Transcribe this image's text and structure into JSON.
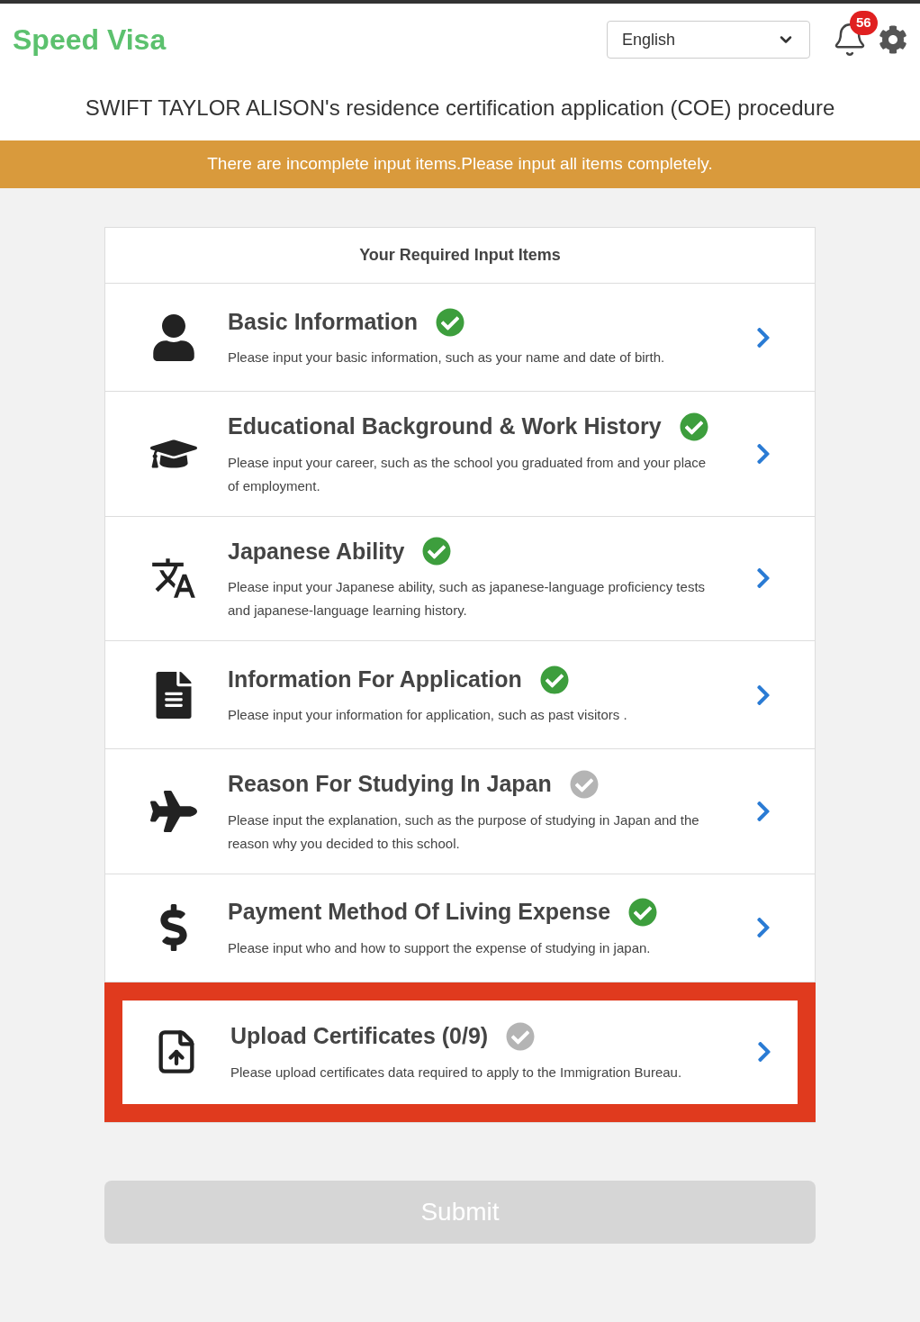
{
  "header": {
    "logo": "Speed Visa",
    "language": "English",
    "notification_count": "56"
  },
  "title": "SWIFT TAYLOR ALISON's residence certification application (COE) procedure",
  "alert": "There are incomplete input items.Please input all items completely.",
  "card": {
    "heading": "Your Required Input Items",
    "items": [
      {
        "title": "Basic Information",
        "description": "Please input your basic information, such as your name and date of birth.",
        "completed": true,
        "highlighted": false
      },
      {
        "title": "Educational Background & Work History",
        "description": "Please input your career, such as the school you graduated from and your place of employment.",
        "completed": true,
        "highlighted": false
      },
      {
        "title": "Japanese Ability",
        "description": "Please input your Japanese ability, such as japanese-language proficiency tests and japanese-language learning history.",
        "completed": true,
        "highlighted": false
      },
      {
        "title": "Information For Application",
        "description": "Please input your information for application, such as past visitors .",
        "completed": true,
        "highlighted": false
      },
      {
        "title": "Reason For Studying In Japan",
        "description": "Please input the explanation, such as the purpose of studying in Japan and the reason why you decided to this school.",
        "completed": false,
        "highlighted": false
      },
      {
        "title": "Payment Method Of Living Expense",
        "description": "Please input who and how to support the expense of studying in japan.",
        "completed": true,
        "highlighted": false
      },
      {
        "title": "Upload Certificates (0/9)",
        "description": "Please upload certificates data required to apply to the Immigration Bureau.",
        "completed": false,
        "highlighted": true
      }
    ]
  },
  "submit": {
    "label": "Submit",
    "disabled": true
  }
}
